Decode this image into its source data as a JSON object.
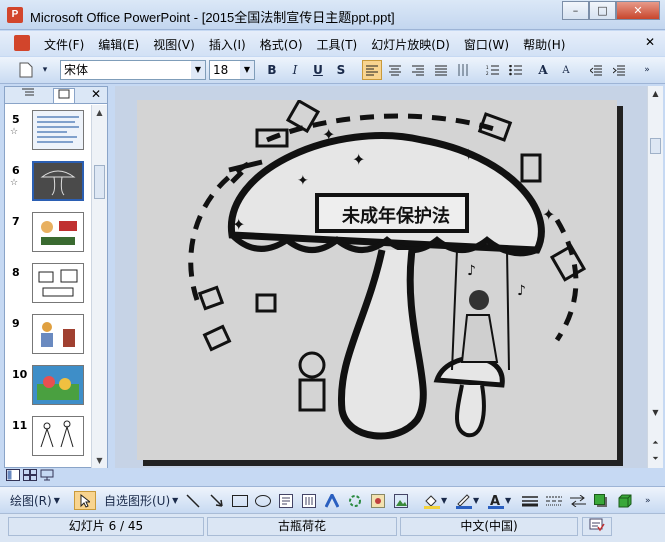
{
  "window": {
    "title": "Microsoft Office PowerPoint - [2015全国法制宣传日主题ppt.ppt]",
    "app_icon_label": "P",
    "controls": {
      "minimize": "–",
      "maximize": "□",
      "close": "✕"
    }
  },
  "menu": {
    "items": [
      "文件(F)",
      "编辑(E)",
      "视图(V)",
      "插入(I)",
      "格式(O)",
      "工具(T)",
      "幻灯片放映(D)",
      "窗口(W)",
      "帮助(H)"
    ],
    "close": "✕"
  },
  "format_toolbar": {
    "font_name": "宋体",
    "font_size": "18",
    "bold": "B",
    "italic": "I",
    "underline": "U",
    "shadow": "S",
    "grow_font": "A",
    "shrink_font": "A"
  },
  "outline_pane": {
    "tabs": [
      "outline",
      "slides"
    ],
    "close": "✕",
    "slides": [
      {
        "number": "5",
        "star": "☆"
      },
      {
        "number": "6",
        "star": "☆",
        "selected": true
      },
      {
        "number": "7"
      },
      {
        "number": "8"
      },
      {
        "number": "9"
      },
      {
        "number": "10"
      },
      {
        "number": "11"
      }
    ]
  },
  "slide": {
    "banner_text": "未成年保护法"
  },
  "draw_toolbar": {
    "draw_label": "绘图(R)",
    "autoshapes_label": "自选图形(U)"
  },
  "status": {
    "slide_counter": "幻灯片 6 / 45",
    "design": "古瓶荷花",
    "language": "中文(中国)"
  },
  "colors": {
    "accent": "#2b5fb3",
    "titlebar": "#c3d6ef",
    "close_button": "#c8462c"
  }
}
